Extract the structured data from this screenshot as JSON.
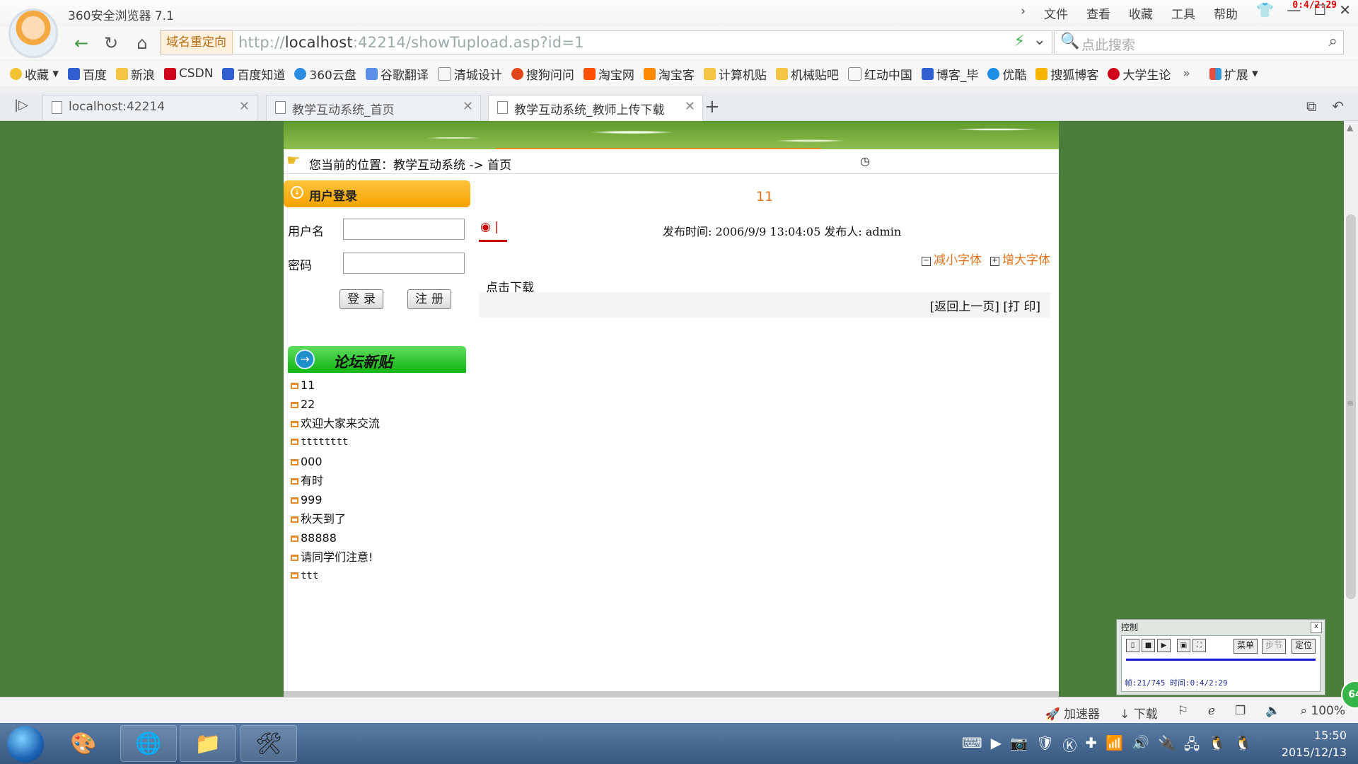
{
  "browser": {
    "title": "360安全浏览器 7.1",
    "menu": [
      "文件",
      "查看",
      "收藏",
      "工具",
      "帮助"
    ],
    "record_time": "0:4/2:29",
    "redirect_tag": "域名重定向",
    "url_prefix": "http://",
    "url_host": "localhost",
    "url_rest": ":42214/showTupload.asp?id=1",
    "search_placeholder": "点此搜索",
    "bookmarks": [
      "收藏",
      "百度",
      "新浪",
      "CSDN",
      "百度知道",
      "360云盘",
      "谷歌翻译",
      "清城设计",
      "搜狗问问",
      "淘宝网",
      "淘宝客",
      "计算机贴",
      "机械贴吧",
      "红动中国",
      "博客_毕",
      "优酷",
      "搜狐博客",
      "大学生论",
      "扩展"
    ],
    "tabs": [
      {
        "label": "localhost:42214"
      },
      {
        "label": "教学互动系统_首页"
      },
      {
        "label": "教学互动系统_教师上传下载"
      }
    ],
    "status": [
      "加速器",
      "下载",
      "100%"
    ]
  },
  "page": {
    "breadcrumb": "您当前的位置：教学互动系统 -> 首页",
    "login": {
      "heading": "用户登录",
      "username_label": "用户名",
      "password_label": "密码",
      "login_button": "登录",
      "register_button": "注册"
    },
    "forum": {
      "heading": "论坛新贴",
      "items": [
        "11",
        "22",
        "欢迎大家来交流",
        "tttttttt",
        "000",
        "有时",
        "999",
        "秋天到了",
        "88888",
        "请同学们注意!",
        "ttt"
      ]
    },
    "article": {
      "title": "11",
      "tag": "|",
      "meta": "发布时间: 2006/9/9 13:04:05  发布人: admin",
      "font_smaller": "减小字体",
      "font_larger": "增大字体",
      "body": "点击下载",
      "footer_links": "[返回上一页] [打 印]"
    }
  },
  "media_control": {
    "title": "控制",
    "menu_button": "菜单",
    "step_button": "步节",
    "locate_button": "定位",
    "info": "帧:21/745 时间:0:4/2:29"
  },
  "taskbar": {
    "time": "15:50",
    "date": "2015/12/13"
  },
  "colors": {
    "page_bg": "#4b7d3c",
    "accent_orange": "#e0731a",
    "login_header": "#f5a300",
    "forum_header": "#12b412"
  }
}
